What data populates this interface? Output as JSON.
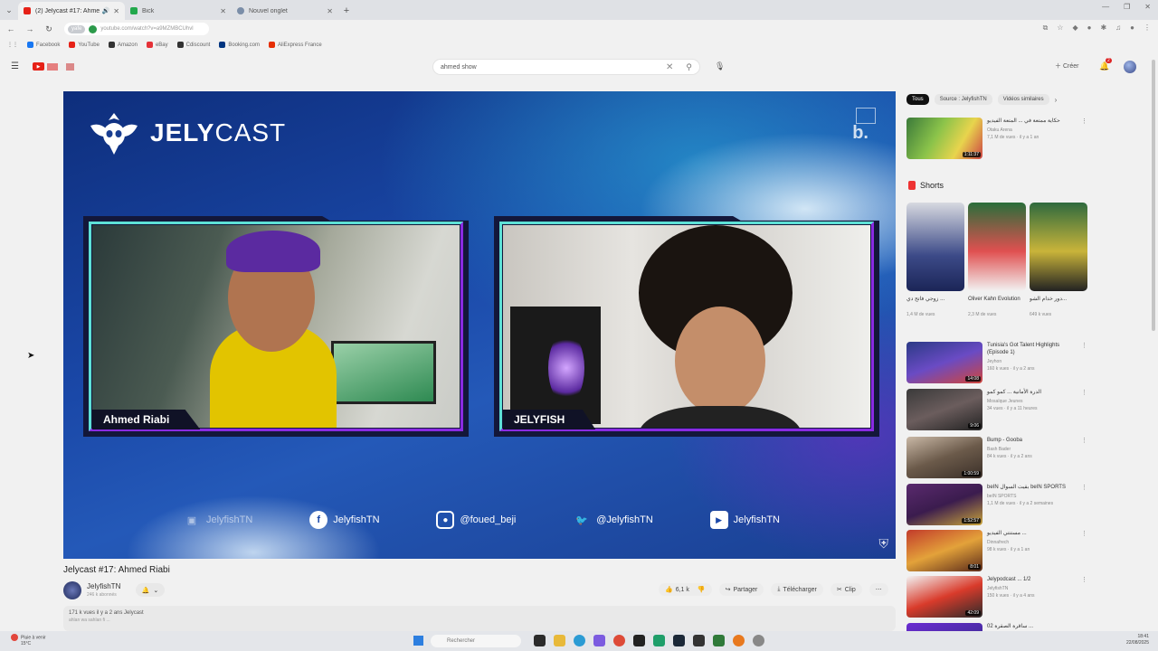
{
  "browser": {
    "tabs": [
      {
        "title": "(2) Jelycast #17: Ahmed Ri...",
        "active": true,
        "color": "#e62117"
      },
      {
        "title": "Bick",
        "active": false,
        "color": "#22a84c"
      },
      {
        "title": "Nouvel onglet",
        "active": false,
        "color": "#7b8ea8"
      }
    ],
    "url": "youtube.com/watch?v=a9MZMBCUhvl",
    "url_badge": "yafe",
    "bookmarks": [
      {
        "label": "Facebook",
        "color": "#1877f2"
      },
      {
        "label": "YouTube",
        "color": "#e62117"
      },
      {
        "label": "Amazon",
        "color": "#333333"
      },
      {
        "label": "eBay",
        "color": "#e53238"
      },
      {
        "label": "Cdiscount",
        "color": "#333333"
      },
      {
        "label": "Booking.com",
        "color": "#003580"
      },
      {
        "label": "AliExpress France",
        "color": "#e62e04"
      }
    ]
  },
  "youtube": {
    "search_query": "ahmed show",
    "create_label": "Créer",
    "notification_count": "2"
  },
  "video": {
    "brand": {
      "bold": "JELY",
      "light": "CAST"
    },
    "guest_name": "Ahmed Riabi",
    "host_name": "JELYFISH",
    "socials": [
      {
        "icon": "twitch-icon",
        "label": "JelyfishTN",
        "glyph": "▣",
        "dim": true
      },
      {
        "icon": "facebook-icon",
        "label": "JelyfishTN",
        "glyph": "f",
        "dim": false
      },
      {
        "icon": "instagram-icon",
        "label": "@foued_beji",
        "glyph": "◎",
        "dim": false
      },
      {
        "icon": "twitter-icon",
        "label": "@JelyfishTN",
        "glyph": "🐦",
        "dim": false
      },
      {
        "icon": "youtube-icon",
        "label": "JelyfishTN",
        "glyph": "▶",
        "dim": false
      }
    ],
    "title": "Jelycast #17: Ahmed Riabi",
    "channel": "JelyfishTN",
    "subscribers": "246 k abonnés",
    "likes": "6,1 k",
    "share_label": "Partager",
    "download_label": "Télécharger",
    "clip_label": "Clip",
    "desc_line1": "171 k vues  il y a 2 ans  Jelycast",
    "desc_line2": "ahlan wa sahlan fi ..."
  },
  "sidebar": {
    "chips": [
      "Tous",
      "Source : JelyfishTN",
      "Vidéos similaires"
    ],
    "first_rec": {
      "title": "حكاية ممتعة في ... المتعة الفيديو",
      "channel": "Otaku Arena",
      "views": "7,1 M de vues · il y a 1 an",
      "duration": "1:11:37"
    },
    "shorts_label": "Shorts",
    "shorts": [
      {
        "title": "زوجي فاتح دي ...",
        "views": "1,4 M de vues"
      },
      {
        "title": "Oliver Kahn Evolution",
        "views": "2,3 M de vues"
      },
      {
        "title": "دور خدام الشو...",
        "views": "649 k vues"
      }
    ],
    "recs": [
      {
        "title": "Tunisia's Got Talent Highlights (Episode 1)",
        "channel": "Jeyhon",
        "views": "160 k vues · il y a 2 ans",
        "duration": "14:08"
      },
      {
        "title": "الدرة الأمانية ... كمو كمو",
        "channel": "Mosaïque Jeunes",
        "views": "34 vues · il y a 11 heures",
        "duration": "9:06"
      },
      {
        "title": "Bump - Gooba",
        "channel": "Bash Bader",
        "views": "84 k vues · il y a 2 ans",
        "duration": "1:00:59"
      },
      {
        "title": "beIN بقيت السوال beIN SPORTS",
        "channel": "beIN SPORTS",
        "views": "1,1 M de vues · il y a 2 semaines",
        "duration": "1:52:57"
      },
      {
        "title": "مستنتي الفيديو ...",
        "channel": "Dinnafrech",
        "views": "98 k vues · il y a 1 an",
        "duration": "8:01"
      },
      {
        "title": "Jelypodcast ... 1/2",
        "channel": "JelyfishTN",
        "views": "150 k vues · il y a 4 ans",
        "duration": "42:09"
      },
      {
        "title": "ساقرة الصقرة 02 ...",
        "channel": "",
        "views": "",
        "duration": ""
      }
    ]
  },
  "taskbar": {
    "weather_line1": "Pluie à venir",
    "weather_line2": "15°C",
    "search_placeholder": "Rechercher",
    "time": "18:41",
    "date": "22/08/2025"
  }
}
